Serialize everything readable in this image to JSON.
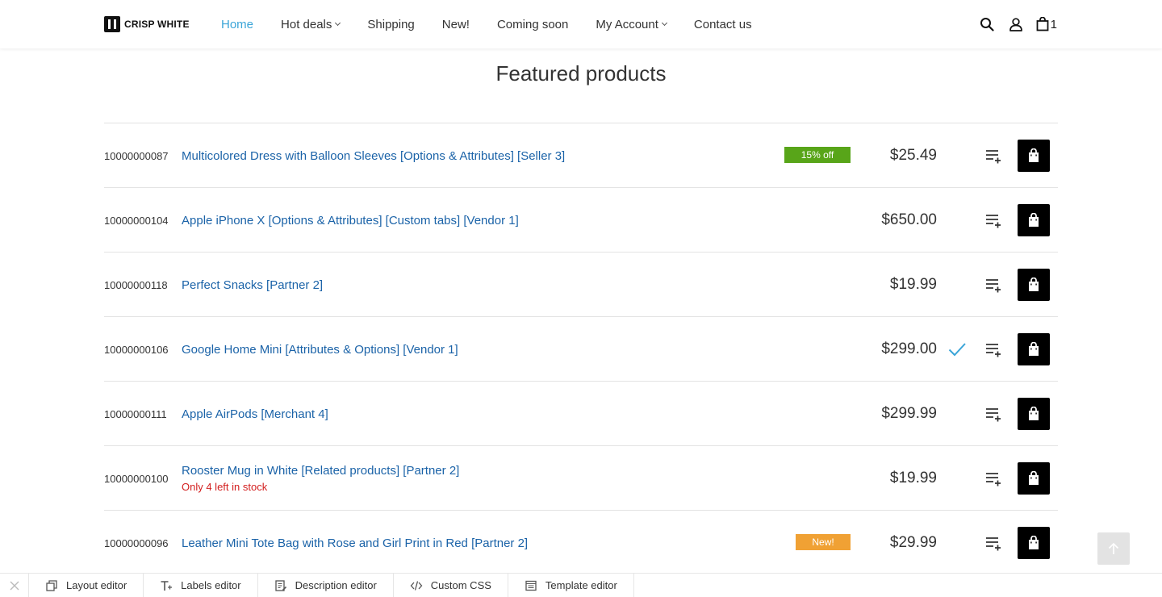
{
  "brand": {
    "name": "CRISP WHITE"
  },
  "nav": {
    "items": [
      {
        "label": "Home",
        "active": true,
        "dropdown": false
      },
      {
        "label": "Hot deals",
        "active": false,
        "dropdown": true
      },
      {
        "label": "Shipping",
        "active": false,
        "dropdown": false
      },
      {
        "label": "New!",
        "active": false,
        "dropdown": false
      },
      {
        "label": "Coming soon",
        "active": false,
        "dropdown": false
      },
      {
        "label": "My Account",
        "active": false,
        "dropdown": true
      },
      {
        "label": "Contact us",
        "active": false,
        "dropdown": false
      }
    ],
    "active_color": "#3ba5d8"
  },
  "header_icons": {
    "search": "search-icon",
    "account": "user-icon",
    "cart": "bag-icon",
    "cart_count": "1"
  },
  "main": {
    "title": "Featured products",
    "products": [
      {
        "code": "10000000087",
        "name": "Multicolored Dress with Balloon Sleeves [Options & Attributes] [Seller 3]",
        "badge": "15% off",
        "badge_type": "discount",
        "price": "$25.49",
        "stock_note": "",
        "compared": false
      },
      {
        "code": "10000000104",
        "name": "Apple iPhone X [Options & Attributes] [Custom tabs] [Vendor 1]",
        "badge": "",
        "badge_type": "",
        "price": "$650.00",
        "stock_note": "",
        "compared": false
      },
      {
        "code": "10000000118",
        "name": "Perfect Snacks [Partner 2]",
        "badge": "",
        "badge_type": "",
        "price": "$19.99",
        "stock_note": "",
        "compared": false
      },
      {
        "code": "10000000106",
        "name": "Google Home Mini [Attributes & Options] [Vendor 1]",
        "badge": "",
        "badge_type": "",
        "price": "$299.00",
        "stock_note": "",
        "compared": true
      },
      {
        "code": "10000000111",
        "name": "Apple AirPods [Merchant 4]",
        "badge": "",
        "badge_type": "",
        "price": "$299.99",
        "stock_note": "",
        "compared": false
      },
      {
        "code": "10000000100",
        "name": "Rooster Mug in White [Related products] [Partner 2]",
        "badge": "",
        "badge_type": "",
        "price": "$19.99",
        "stock_note": "Only 4 left in stock",
        "compared": false
      },
      {
        "code": "10000000096",
        "name": "Leather Mini Tote Bag with Rose and Girl Print in Red [Partner 2]",
        "badge": "New!",
        "badge_type": "new",
        "price": "$29.99",
        "stock_note": "",
        "compared": false
      }
    ]
  },
  "colors": {
    "link": "#1b63a8",
    "discount_badge": "#58a519",
    "new_badge": "#f0a134",
    "stock_warning": "#d32020",
    "check": "#3ba5d8"
  },
  "editor_bar": {
    "items": [
      {
        "label": "Layout editor",
        "icon": "layout-icon"
      },
      {
        "label": "Labels editor",
        "icon": "text-icon"
      },
      {
        "label": "Description editor",
        "icon": "description-icon"
      },
      {
        "label": "Custom CSS",
        "icon": "code-icon"
      },
      {
        "label": "Template editor",
        "icon": "template-icon"
      }
    ]
  }
}
